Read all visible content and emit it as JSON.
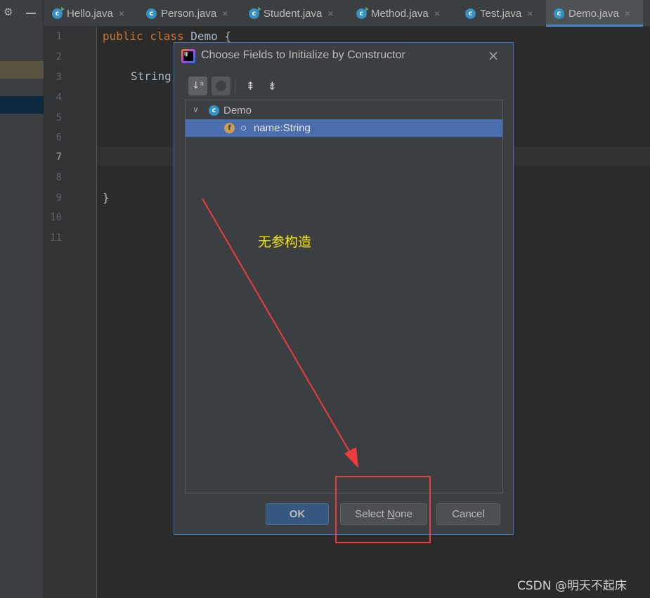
{
  "tabs": [
    {
      "label": "Hello.java",
      "run": true
    },
    {
      "label": "Person.java",
      "run": false
    },
    {
      "label": "Student.java",
      "run": true
    },
    {
      "label": "Method.java",
      "run": true
    },
    {
      "label": "Test.java",
      "run": false
    },
    {
      "label": "Demo.java",
      "run": false,
      "active": true
    }
  ],
  "tab_close_glyph": "×",
  "class_icon_letter": "c",
  "editor": {
    "line_numbers": [
      "1",
      "2",
      "3",
      "4",
      "5",
      "6",
      "7",
      "8",
      "9",
      "10",
      "11"
    ],
    "current_line": "7",
    "code": {
      "line1_kw": "public class",
      "line1_name": "Demo",
      "line1_brace": "{",
      "line3": "String",
      "line9": "}"
    }
  },
  "dialog": {
    "title": "Choose Fields to Initialize by Constructor",
    "close_glyph": "×",
    "logo_text": "IJ",
    "toolbar": {
      "sort_icon": "sort-alphabetically-icon",
      "sort_glyph": "↓ᵃ",
      "expand_glyph": "⇞",
      "collapse_glyph": "⇟"
    },
    "tree": {
      "root_label": "Demo",
      "root_chevron": "∨",
      "field_icon_letter": "f",
      "field_label": "name:String"
    },
    "buttons": {
      "ok": "OK",
      "select_none_prefix": "Select ",
      "select_none_mnemonic": "N",
      "select_none_suffix": "one",
      "cancel": "Cancel"
    }
  },
  "annotation": {
    "text": "无参构造",
    "color": "#f5e500",
    "arrow_color": "#ee3b3b"
  },
  "watermark": "CSDN @明天不起床",
  "colors": {
    "selection": "#4b6eaf",
    "keyword": "#cc7832",
    "dialog_border": "#3574b6"
  }
}
